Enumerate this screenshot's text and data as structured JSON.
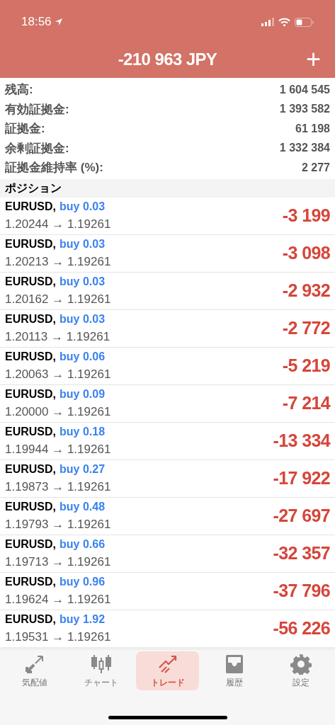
{
  "status_bar": {
    "time": "18:56"
  },
  "header": {
    "title": "-210 963 JPY",
    "action": "+"
  },
  "summary": [
    {
      "label": "残高:",
      "value": "1 604 545"
    },
    {
      "label": "有効証拠金:",
      "value": "1 393 582"
    },
    {
      "label": "証拠金:",
      "value": "61 198"
    },
    {
      "label": "余剰証拠金:",
      "value": "1 332 384"
    },
    {
      "label": "証拠金維持率 (%):",
      "value": "2 277"
    }
  ],
  "section_title": "ポジション",
  "positions": [
    {
      "symbol": "EURUSD,",
      "side": "buy 0.03",
      "prices": "1.20244 → 1.19261",
      "profit": "-3 199"
    },
    {
      "symbol": "EURUSD,",
      "side": "buy 0.03",
      "prices": "1.20213 → 1.19261",
      "profit": "-3 098"
    },
    {
      "symbol": "EURUSD,",
      "side": "buy 0.03",
      "prices": "1.20162 → 1.19261",
      "profit": "-2 932"
    },
    {
      "symbol": "EURUSD,",
      "side": "buy 0.03",
      "prices": "1.20113 → 1.19261",
      "profit": "-2 772"
    },
    {
      "symbol": "EURUSD,",
      "side": "buy 0.06",
      "prices": "1.20063 → 1.19261",
      "profit": "-5 219"
    },
    {
      "symbol": "EURUSD,",
      "side": "buy 0.09",
      "prices": "1.20000 → 1.19261",
      "profit": "-7 214"
    },
    {
      "symbol": "EURUSD,",
      "side": "buy 0.18",
      "prices": "1.19944 → 1.19261",
      "profit": "-13 334"
    },
    {
      "symbol": "EURUSD,",
      "side": "buy 0.27",
      "prices": "1.19873 → 1.19261",
      "profit": "-17 922"
    },
    {
      "symbol": "EURUSD,",
      "side": "buy 0.48",
      "prices": "1.19793 → 1.19261",
      "profit": "-27 697"
    },
    {
      "symbol": "EURUSD,",
      "side": "buy 0.66",
      "prices": "1.19713 → 1.19261",
      "profit": "-32 357"
    },
    {
      "symbol": "EURUSD,",
      "side": "buy 0.96",
      "prices": "1.19624 → 1.19261",
      "profit": "-37 796"
    },
    {
      "symbol": "EURUSD,",
      "side": "buy 1.92",
      "prices": "1.19531 → 1.19261",
      "profit": "-56 226"
    }
  ],
  "tabs": [
    {
      "kind": "quotes",
      "label": "気配値",
      "selected": false
    },
    {
      "kind": "chart",
      "label": "チャート",
      "selected": false
    },
    {
      "kind": "trade",
      "label": "トレード",
      "selected": true
    },
    {
      "kind": "history",
      "label": "履歴",
      "selected": false
    },
    {
      "kind": "settings",
      "label": "設定",
      "selected": false
    }
  ]
}
